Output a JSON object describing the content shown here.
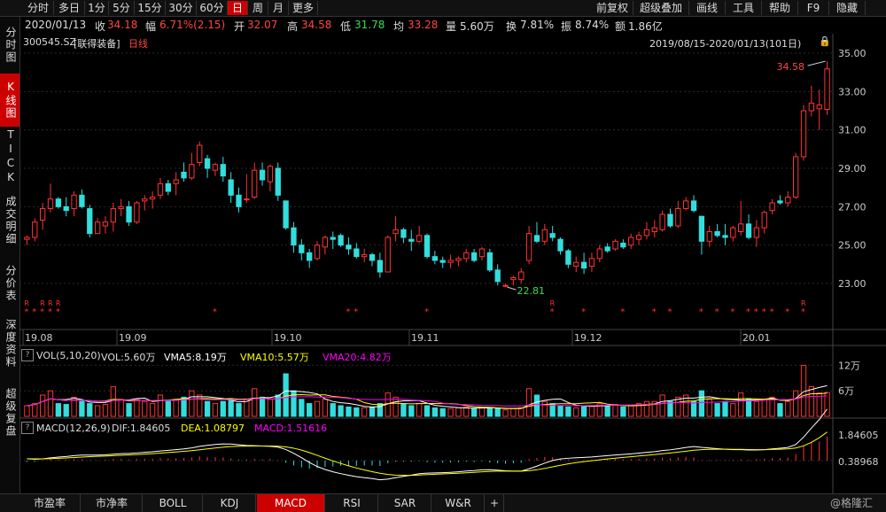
{
  "toolbar": {
    "left_buttons": [
      "分时",
      "多日",
      "1分",
      "5分",
      "15分",
      "30分",
      "60分",
      "日",
      "周",
      "月",
      "更多"
    ],
    "active": "日",
    "right_buttons": [
      "前复权",
      "超级叠加",
      "画线",
      "工具",
      "帮助",
      "F9",
      "隐藏"
    ]
  },
  "quote": {
    "date": "2020/01/13",
    "close_label": "收",
    "close": "34.18",
    "change_label": "幅",
    "change": "6.71%(2.15)",
    "open_label": "开",
    "open": "32.07",
    "high_label": "高",
    "high": "34.58",
    "low_label": "低",
    "low": "31.78",
    "avg_label": "均",
    "avg": "33.28",
    "vol_label": "量",
    "vol": "5.60万",
    "turnover_label": "换",
    "turnover": "7.81%",
    "amplitude_label": "振",
    "amplitude": "8.74%",
    "amount_label": "额",
    "amount": "1.86亿"
  },
  "stock": {
    "code": "300545.SZ",
    "name": "[联得装备]",
    "period": "日线",
    "range": "2019/08/15-2020/01/13(101日)"
  },
  "rail": [
    "分时图",
    "K线图",
    "TICK",
    "成交明细",
    "分价表",
    "深度资料",
    "超级复盘"
  ],
  "rail_active": "K线图",
  "price_axis": [
    "35.00",
    "33.00",
    "31.00",
    "29.00",
    "27.00",
    "25.00",
    "23.00"
  ],
  "date_axis": [
    "19.08",
    "19.09",
    "19.10",
    "19.11",
    "19.12",
    "20.01"
  ],
  "annotations": {
    "high": "34.58",
    "low": "22.81"
  },
  "vol_panel": {
    "title": "VOL(5,10,20)",
    "vol": "VOL:5.60万",
    "vma5": "VMA5:8.19万",
    "vma10": "VMA10:5.57万",
    "vma20": "VMA20:4.82万",
    "axis": [
      "12万",
      "6万"
    ]
  },
  "macd_panel": {
    "title": "MACD(12,26,9)",
    "dif": "DIF:1.84605",
    "dea": "DEA:1.08797",
    "macd": "MACD:1.51616",
    "axis": [
      "1.84605",
      "0.38968"
    ]
  },
  "bottom_tabs": [
    "市盈率",
    "市净率",
    "BOLL",
    "KDJ",
    "MACD",
    "RSI",
    "SAR",
    "W&R",
    "+"
  ],
  "bottom_active": "MACD",
  "watermark": "@格隆汇",
  "colors": {
    "up": "#ff3333",
    "down": "#33dddd",
    "accent": "#cc0000",
    "vma5": "#ffffff",
    "vma10": "#ffff00",
    "vma20": "#ff00ff"
  },
  "chart_data": {
    "type": "candlestick",
    "y_range": [
      22.0,
      35.5
    ],
    "candles": [
      [
        25.3,
        25.5,
        25.0,
        25.4
      ],
      [
        25.4,
        26.4,
        25.2,
        26.2
      ],
      [
        26.3,
        27.2,
        25.8,
        26.9
      ],
      [
        26.9,
        28.2,
        26.7,
        27.4
      ],
      [
        27.4,
        27.5,
        26.9,
        27.0
      ],
      [
        27.0,
        27.5,
        26.5,
        26.8
      ],
      [
        26.9,
        27.8,
        26.5,
        27.6
      ],
      [
        27.6,
        27.9,
        26.9,
        27.0
      ],
      [
        26.9,
        27.1,
        25.4,
        25.6
      ],
      [
        25.6,
        26.4,
        25.6,
        26.2
      ],
      [
        26.0,
        26.5,
        25.6,
        26.2
      ],
      [
        26.2,
        27.2,
        25.7,
        26.9
      ],
      [
        26.9,
        27.4,
        26.5,
        27.0
      ],
      [
        27.0,
        27.3,
        26.0,
        26.2
      ],
      [
        26.2,
        27.3,
        26.1,
        27.2
      ],
      [
        27.3,
        27.6,
        26.8,
        27.4
      ],
      [
        27.4,
        27.8,
        26.9,
        27.5
      ],
      [
        27.6,
        28.5,
        27.4,
        28.2
      ],
      [
        28.2,
        28.4,
        27.6,
        27.8
      ],
      [
        28.2,
        28.8,
        27.6,
        28.4
      ],
      [
        28.8,
        29.3,
        28.3,
        28.5
      ],
      [
        28.5,
        29.8,
        28.4,
        29.2
      ],
      [
        29.3,
        30.4,
        29.1,
        30.2
      ],
      [
        29.5,
        29.7,
        28.5,
        29.0
      ],
      [
        28.9,
        29.3,
        28.6,
        29.2
      ],
      [
        29.2,
        29.6,
        28.3,
        28.6
      ],
      [
        28.4,
        28.8,
        27.2,
        27.6
      ],
      [
        27.6,
        28.0,
        26.7,
        27.0
      ],
      [
        27.4,
        28.7,
        27.2,
        27.4
      ],
      [
        27.5,
        29.3,
        27.4,
        28.9
      ],
      [
        28.9,
        29.3,
        28.1,
        28.4
      ],
      [
        28.3,
        29.2,
        27.8,
        29.1
      ],
      [
        29.0,
        29.3,
        27.3,
        27.6
      ],
      [
        27.3,
        27.3,
        25.8,
        25.9
      ],
      [
        25.9,
        26.2,
        24.6,
        25.0
      ],
      [
        25.0,
        25.3,
        24.2,
        24.6
      ],
      [
        24.6,
        24.8,
        23.8,
        24.2
      ],
      [
        24.3,
        25.2,
        24.2,
        25.0
      ],
      [
        24.9,
        25.5,
        24.5,
        25.4
      ],
      [
        25.4,
        25.7,
        24.8,
        25.3
      ],
      [
        25.5,
        25.6,
        24.9,
        25.0
      ],
      [
        25.0,
        25.4,
        24.5,
        24.8
      ],
      [
        24.8,
        25.1,
        24.3,
        24.4
      ],
      [
        24.4,
        24.8,
        24.1,
        24.5
      ],
      [
        24.5,
        24.6,
        23.9,
        24.2
      ],
      [
        24.2,
        24.6,
        23.3,
        23.6
      ],
      [
        23.6,
        25.5,
        23.6,
        25.4
      ],
      [
        25.6,
        26.5,
        25.2,
        25.8
      ],
      [
        25.8,
        25.9,
        25.1,
        25.4
      ],
      [
        25.3,
        25.8,
        24.7,
        25.2
      ],
      [
        25.2,
        26.0,
        25.1,
        25.5
      ],
      [
        25.5,
        25.6,
        24.3,
        24.4
      ],
      [
        24.4,
        24.7,
        24.0,
        24.2
      ],
      [
        24.2,
        24.4,
        23.8,
        24.1
      ],
      [
        24.1,
        24.5,
        23.8,
        24.2
      ],
      [
        24.2,
        24.4,
        23.9,
        24.3
      ],
      [
        24.3,
        24.8,
        24.1,
        24.6
      ],
      [
        24.6,
        24.8,
        24.1,
        24.2
      ],
      [
        24.4,
        24.9,
        24.2,
        24.8
      ],
      [
        24.6,
        24.8,
        23.6,
        23.7
      ],
      [
        23.7,
        24.0,
        22.9,
        23.1
      ],
      [
        22.9,
        23.0,
        22.8,
        22.9
      ],
      [
        23.2,
        23.4,
        22.9,
        23.3
      ],
      [
        23.2,
        23.8,
        23.0,
        23.6
      ],
      [
        24.2,
        26.0,
        24.0,
        25.6
      ],
      [
        25.5,
        26.2,
        25.1,
        25.2
      ],
      [
        25.2,
        26.1,
        25.0,
        25.8
      ],
      [
        25.6,
        26.0,
        25.2,
        25.4
      ],
      [
        25.3,
        25.4,
        24.5,
        24.7
      ],
      [
        24.7,
        24.8,
        23.8,
        24.0
      ],
      [
        23.9,
        24.4,
        23.6,
        24.1
      ],
      [
        24.1,
        24.6,
        23.5,
        23.8
      ],
      [
        23.9,
        24.6,
        23.6,
        24.3
      ],
      [
        24.3,
        25.0,
        24.1,
        24.8
      ],
      [
        24.9,
        25.1,
        24.6,
        24.7
      ],
      [
        24.8,
        25.3,
        24.7,
        25.2
      ],
      [
        25.1,
        25.3,
        24.8,
        24.9
      ],
      [
        25.0,
        25.6,
        24.8,
        25.4
      ],
      [
        25.3,
        25.7,
        25.0,
        25.5
      ],
      [
        25.5,
        26.2,
        25.3,
        25.8
      ],
      [
        25.7,
        26.3,
        25.4,
        25.9
      ],
      [
        25.8,
        26.8,
        25.7,
        26.6
      ],
      [
        26.6,
        26.9,
        25.9,
        26.0
      ],
      [
        26.0,
        27.3,
        25.9,
        26.9
      ],
      [
        26.9,
        27.5,
        26.8,
        27.3
      ],
      [
        27.3,
        27.6,
        26.7,
        26.8
      ],
      [
        26.5,
        26.5,
        24.5,
        25.2
      ],
      [
        25.2,
        26.0,
        24.9,
        25.7
      ],
      [
        25.7,
        26.1,
        25.4,
        25.5
      ],
      [
        25.5,
        26.1,
        25.0,
        25.4
      ],
      [
        25.4,
        26.0,
        25.2,
        25.9
      ],
      [
        25.7,
        27.3,
        25.5,
        26.1
      ],
      [
        26.1,
        26.6,
        25.3,
        25.4
      ],
      [
        25.4,
        26.3,
        24.9,
        25.9
      ],
      [
        25.9,
        26.8,
        25.6,
        26.7
      ],
      [
        26.8,
        27.4,
        26.6,
        27.2
      ],
      [
        27.3,
        27.6,
        27.1,
        27.2
      ],
      [
        27.2,
        27.8,
        27.0,
        27.5
      ],
      [
        27.5,
        29.8,
        27.4,
        29.6
      ],
      [
        29.6,
        32.3,
        29.4,
        32.0
      ],
      [
        32.0,
        33.3,
        31.7,
        32.4
      ],
      [
        32.1,
        33.1,
        31.0,
        32.3
      ],
      [
        32.07,
        34.58,
        31.78,
        34.18
      ]
    ],
    "volumes": [
      2.5,
      3.0,
      5.0,
      6.0,
      3.0,
      2.8,
      4.5,
      3.5,
      3.0,
      2.5,
      2.8,
      7.0,
      4.0,
      3.0,
      4.0,
      3.5,
      3.0,
      5.0,
      3.5,
      4.0,
      4.5,
      6.0,
      5.0,
      3.5,
      3.0,
      3.5,
      4.0,
      3.0,
      4.0,
      6.5,
      4.5,
      4.0,
      5.0,
      10.0,
      6.0,
      4.0,
      3.0,
      3.5,
      4.0,
      3.0,
      2.5,
      2.2,
      2.0,
      2.0,
      2.2,
      3.0,
      5.5,
      4.5,
      3.0,
      2.5,
      3.0,
      2.5,
      2.0,
      1.8,
      1.8,
      2.0,
      2.2,
      1.8,
      2.0,
      2.0,
      1.8,
      1.5,
      1.8,
      2.0,
      6.5,
      5.0,
      3.5,
      3.0,
      2.5,
      2.2,
      2.0,
      2.5,
      2.5,
      3.0,
      2.5,
      2.8,
      2.2,
      2.5,
      3.0,
      3.5,
      3.5,
      5.0,
      3.5,
      4.5,
      5.0,
      3.5,
      6.0,
      4.0,
      3.0,
      3.5,
      3.0,
      5.5,
      4.0,
      3.5,
      4.0,
      4.5,
      3.0,
      3.5,
      6.0,
      12.0,
      7.0,
      5.5,
      5.6
    ],
    "macd": [
      -0.05,
      -0.04,
      0.02,
      0.06,
      0.05,
      0.04,
      0.06,
      0.05,
      0.02,
      0.02,
      0.03,
      0.06,
      0.06,
      0.04,
      0.06,
      0.07,
      0.07,
      0.09,
      0.08,
      0.09,
      0.1,
      0.12,
      0.16,
      0.14,
      0.13,
      0.12,
      0.08,
      0.04,
      0.04,
      0.07,
      0.05,
      0.06,
      0.02,
      -0.08,
      -0.18,
      -0.25,
      -0.3,
      -0.28,
      -0.24,
      -0.22,
      -0.2,
      -0.2,
      -0.2,
      -0.18,
      -0.18,
      -0.2,
      -0.1,
      -0.04,
      -0.04,
      -0.04,
      -0.02,
      -0.06,
      -0.08,
      -0.08,
      -0.07,
      -0.06,
      -0.04,
      -0.05,
      -0.03,
      -0.07,
      -0.1,
      -0.12,
      -0.1,
      -0.08,
      0.06,
      0.1,
      0.14,
      0.13,
      0.08,
      0.04,
      0.03,
      0.02,
      0.03,
      0.05,
      0.05,
      0.06,
      0.05,
      0.06,
      0.07,
      0.08,
      0.08,
      0.11,
      0.09,
      0.12,
      0.14,
      0.12,
      0.02,
      0.03,
      0.02,
      0.02,
      0.03,
      0.05,
      0.03,
      0.05,
      0.07,
      0.1,
      0.1,
      0.11,
      0.25,
      0.55,
      0.7,
      0.72,
      0.9
    ]
  }
}
